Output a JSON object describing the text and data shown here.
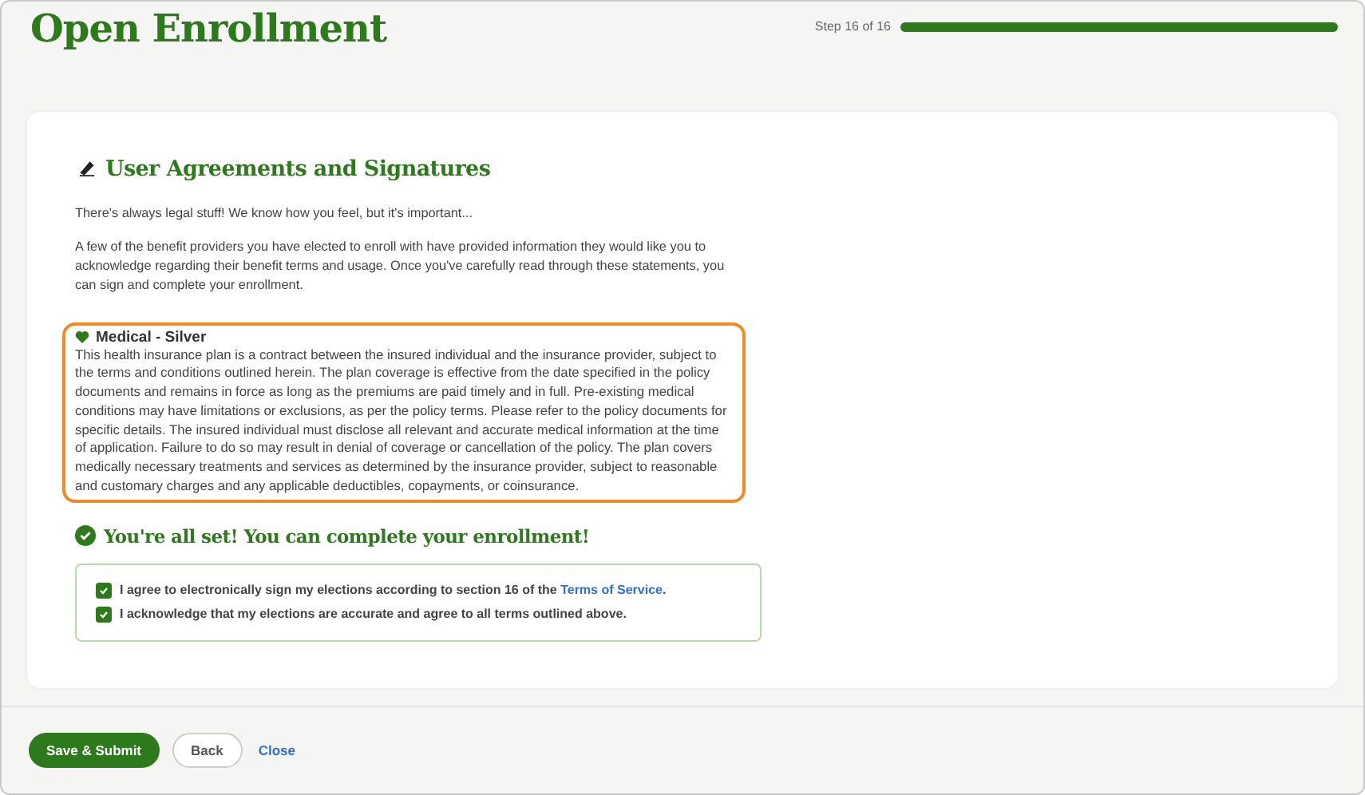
{
  "page": {
    "title": "Open Enrollment"
  },
  "progress": {
    "label": "Step 16 of 16",
    "level": 1
  },
  "section": {
    "title": "User Agreements and Signatures",
    "paragraphs": [
      "There's always legal stuff! We know how you feel, but it's important...",
      "A few of the benefit providers you have elected to enroll with have provided information they would like you to acknowledge regarding their benefit terms and usage. Once you've carefully read through these statements, you can sign and complete your enrollment."
    ]
  },
  "agreements": [
    {
      "title": "Medical - Silver",
      "selected": true,
      "text": "This health insurance plan is a contract between the insured individual and the insurance provider, subject to the terms and conditions outlined herein. The plan coverage is effective from the date specified in the policy documents and remains in force as long as the premiums are paid timely and in full. Pre-existing medical conditions may have limitations or exclusions, as per the policy terms. Please refer to the policy documents for specific details. The insured individual must disclose all relevant and accurate medical information at the time of application. Failure to do so may result in denial of coverage or cancellation of the policy. The plan covers medically necessary treatments and services as determined by the insurance provider, subject to reasonable and customary charges and any applicable deductibles, copayments, or coinsurance."
    }
  ],
  "status": {
    "message": "You're all set! You can complete your enrollment!"
  },
  "checkboxes": [
    {
      "text": "I agree to electronically sign my elections according to section 16 of the ",
      "link": "Terms of Service",
      "after": ".",
      "checked": true
    },
    {
      "text": "I acknowledge that my elections are accurate and agree to all terms outlined above.",
      "checked": true
    }
  ],
  "buttons": [
    {
      "kind": "primary",
      "label": "Save & Submit"
    },
    {
      "kind": "secondary",
      "label": "Back"
    },
    {
      "kind": "link",
      "label": "Close"
    }
  ]
}
